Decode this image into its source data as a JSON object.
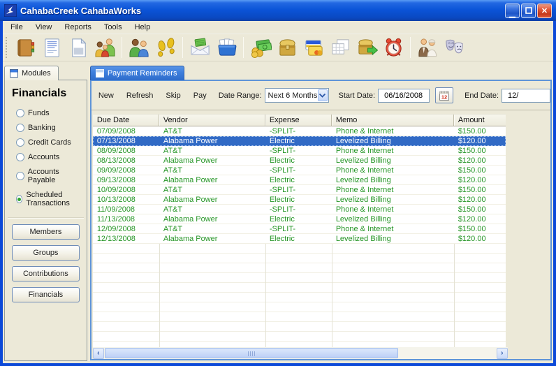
{
  "window": {
    "title": "CahabaCreek CahabaWorks"
  },
  "window_controls": {
    "minimize": "minimize",
    "maximize": "maximize",
    "close": "close"
  },
  "menu": {
    "items": [
      "File",
      "View",
      "Reports",
      "Tools",
      "Help"
    ]
  },
  "toolbar": {
    "groups": [
      [
        "address-book-icon",
        "report-icon",
        "new-document-icon",
        "family-icon"
      ],
      [
        "people-icon",
        "footprints-icon"
      ],
      [
        "contribution-envelope-icon",
        "card-file-icon"
      ],
      [
        "funds-icon",
        "banking-icon",
        "credit-cards-icon",
        "accounts-icon",
        "accounts-payable-icon",
        "scheduled-transactions-icon"
      ],
      [
        "couple-icon",
        "masks-icon"
      ]
    ]
  },
  "sidebar": {
    "tab_label": "Modules",
    "heading": "Financials",
    "options": [
      {
        "label": "Funds",
        "selected": false
      },
      {
        "label": "Banking",
        "selected": false
      },
      {
        "label": "Credit Cards",
        "selected": false
      },
      {
        "label": "Accounts",
        "selected": false
      },
      {
        "label": "Accounts Payable",
        "selected": false
      },
      {
        "label": "Scheduled Transactions",
        "selected": true
      }
    ],
    "nav_buttons": [
      "Members",
      "Groups",
      "Contributions",
      "Financials"
    ]
  },
  "main": {
    "tab_label": "Payment Reminders",
    "actions": [
      "New",
      "Refresh",
      "Skip",
      "Pay"
    ],
    "date_range": {
      "label": "Date Range:",
      "value": "Next 6 Months"
    },
    "start_date": {
      "label": "Start Date:",
      "value": "06/16/2008"
    },
    "end_date": {
      "label": "End Date:",
      "value": "12/"
    },
    "table": {
      "columns": [
        "Due Date",
        "Vendor",
        "Expense",
        "Memo",
        "Amount"
      ],
      "selected_row_index": 1,
      "rows": [
        [
          "07/09/2008",
          "AT&T",
          "-SPLIT-",
          "Phone & Internet",
          "$150.00"
        ],
        [
          "07/13/2008",
          "Alabama Power",
          "Electric",
          "Levelized Billing",
          "$120.00"
        ],
        [
          "08/09/2008",
          "AT&T",
          "-SPLIT-",
          "Phone & Internet",
          "$150.00"
        ],
        [
          "08/13/2008",
          "Alabama Power",
          "Electric",
          "Levelized Billing",
          "$120.00"
        ],
        [
          "09/09/2008",
          "AT&T",
          "-SPLIT-",
          "Phone & Internet",
          "$150.00"
        ],
        [
          "09/13/2008",
          "Alabama Power",
          "Electric",
          "Levelized Billing",
          "$120.00"
        ],
        [
          "10/09/2008",
          "AT&T",
          "-SPLIT-",
          "Phone & Internet",
          "$150.00"
        ],
        [
          "10/13/2008",
          "Alabama Power",
          "Electric",
          "Levelized Billing",
          "$120.00"
        ],
        [
          "11/09/2008",
          "AT&T",
          "-SPLIT-",
          "Phone & Internet",
          "$150.00"
        ],
        [
          "11/13/2008",
          "Alabama Power",
          "Electric",
          "Levelized Billing",
          "$120.00"
        ],
        [
          "12/09/2008",
          "AT&T",
          "-SPLIT-",
          "Phone & Internet",
          "$150.00"
        ],
        [
          "12/13/2008",
          "Alabama Power",
          "Electric",
          "Levelized Billing",
          "$120.00"
        ]
      ]
    }
  },
  "colors": {
    "titlebar_blue": "#0B54D8",
    "window_border": "#0C49D8",
    "client_bg": "#ECE9D8",
    "panel_border_blue": "#5E94D8",
    "selected_tab_blue": "#3D7EDC",
    "row_text_green": "#259525",
    "selection_blue": "#316AC5",
    "radio_dot_green": "#2DA52D"
  }
}
